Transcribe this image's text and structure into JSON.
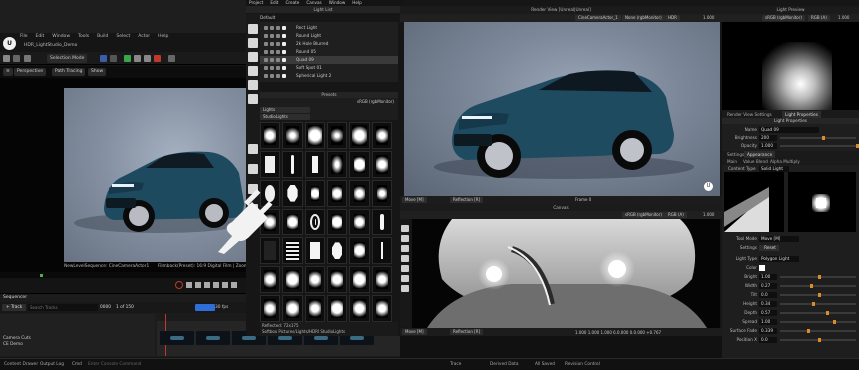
{
  "ue": {
    "logo": "U",
    "menu": [
      "File",
      "Edit",
      "Window",
      "Tools",
      "Build",
      "Select",
      "Actor",
      "Help"
    ],
    "project_tab": "HDR_LightStudio_Demo",
    "selection_mode": "Selection Mode",
    "viewport_buttons": [
      "Perspective",
      "Path Tracing",
      "Show"
    ],
    "viewport_info_left": "NewLevelSequence: CineCameraActor1",
    "viewport_info_right": "Filmback(Preset): 16:9 Digital Film | Zoom: 30mm",
    "sequencer": {
      "title": "Sequencer",
      "track_button": "+ Track",
      "search_placeholder": "Search Tracks",
      "fps": "30 fps",
      "frame": "0000",
      "frame_of": "1 of 150",
      "rows": [
        "Camera Cuts",
        "CE Demo"
      ]
    }
  },
  "status": {
    "items": [
      "Content Drawer",
      "Output Log",
      "Cmd",
      "Enter Console Command",
      "Trace",
      "Derived Data",
      "All Saved",
      "Revision Control"
    ]
  },
  "light_list": {
    "menu": [
      "Project",
      "Edit",
      "Create",
      "Canvas",
      "Window",
      "Help"
    ],
    "title": "Light List",
    "group": "Default",
    "lights": [
      {
        "name": "Rect Light",
        "selected": false
      },
      {
        "name": "Round Light",
        "selected": false
      },
      {
        "name": "2k Hole Blurred",
        "selected": false
      },
      {
        "name": "Round 05",
        "selected": false
      },
      {
        "name": "Quad 09",
        "selected": true
      },
      {
        "name": "Soft Spot 01",
        "selected": false
      },
      {
        "name": "Spherical Light 2",
        "selected": false
      }
    ]
  },
  "presets": {
    "title": "Presets",
    "colorspace": "sRGB (rgbMonitor)",
    "category": "Lights",
    "filter": "StudioLights",
    "footer_line1": "Reflected: 72x175",
    "footer_line2": "Softbox Pictures/Lights/HDRI StudioLights"
  },
  "render_view": {
    "title": "Render View [Unreal|Unreal]",
    "camera": "CineCameraActor_1",
    "colorspace": "None (rgbMonitor)",
    "format": "HDR",
    "exposure": "1.000",
    "mode_move": "Move [M]",
    "mode_reflection": "Reflection [R]",
    "frame": "Frame 0"
  },
  "canvas": {
    "title": "Canvas",
    "colorspace": "sRGB (rgbMonitor)",
    "channels": "RGB (A)",
    "exposure": "1.000",
    "mode_move": "Move [M]",
    "mode_reflection": "Reflection [R]",
    "readout": "1.000 1.000 1.000 6.0.000 0.0.000 +0.767"
  },
  "light_preview": {
    "title": "Light Preview",
    "colorspace": "sRGB (rgbMonitor)",
    "channels": "RGB (A)",
    "exposure": "1.000"
  },
  "light_properties": {
    "tabs": [
      "Render View Settings",
      "Light Properties"
    ],
    "active_tab": "Light Properties",
    "panel_title": "Light Properties",
    "fields": [
      {
        "label": "Name",
        "value": "Quad 09"
      },
      {
        "label": "Brightness",
        "value": "200",
        "level": 0.55
      },
      {
        "label": "Opacity",
        "value": "1.000",
        "level": 1.0
      }
    ],
    "sub_tabs": [
      "Settings",
      "Appearance"
    ],
    "sub_tabs2": [
      "Main",
      "Value Blend",
      "Alpha Multiply"
    ],
    "content_type_label": "Content Type",
    "content_type": "Solid Light",
    "tool_mode_label": "Tool Mode",
    "tool_mode": "Move [M]",
    "settings_label": "Settings",
    "reset_label": "Reset",
    "light_type_label": "Light Type",
    "light_type": "Polygon Light",
    "params": [
      {
        "label": "Color",
        "value": ""
      },
      {
        "label": "Bright",
        "value": "1.00",
        "level": 0.5
      },
      {
        "label": "Width",
        "value": "0.27",
        "level": 0.4
      },
      {
        "label": "Tilt",
        "value": "0.0",
        "level": 0.5
      },
      {
        "label": "Height",
        "value": "0.34",
        "level": 0.42
      },
      {
        "label": "Depth",
        "value": "0.57",
        "level": 0.6
      },
      {
        "label": "Spread",
        "value": "1.00",
        "level": 0.7
      },
      {
        "label": "Surface Fade",
        "value": "0.339",
        "level": 0.35
      },
      {
        "label": "Position X",
        "value": "0.0",
        "level": 0.5
      }
    ]
  }
}
